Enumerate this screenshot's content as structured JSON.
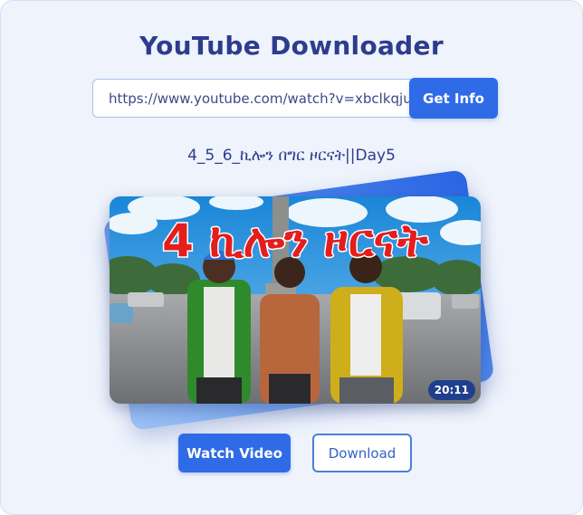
{
  "app": {
    "title": "YouTube Downloader"
  },
  "search": {
    "url_value": "https://www.youtube.com/watch?v=xbclkqjuKk",
    "get_info_label": "Get Info"
  },
  "video": {
    "title": "4_5_6_ኪሎን በግር ዞርናት||Day5",
    "thumbnail_text": "4 ኪሎን ዞርናት",
    "duration": "20:11"
  },
  "actions": {
    "watch_label": "Watch Video",
    "download_label": "Download"
  },
  "colors": {
    "accent": "#2f6be6",
    "title": "#2d3c8c",
    "background": "#eef3fc"
  }
}
